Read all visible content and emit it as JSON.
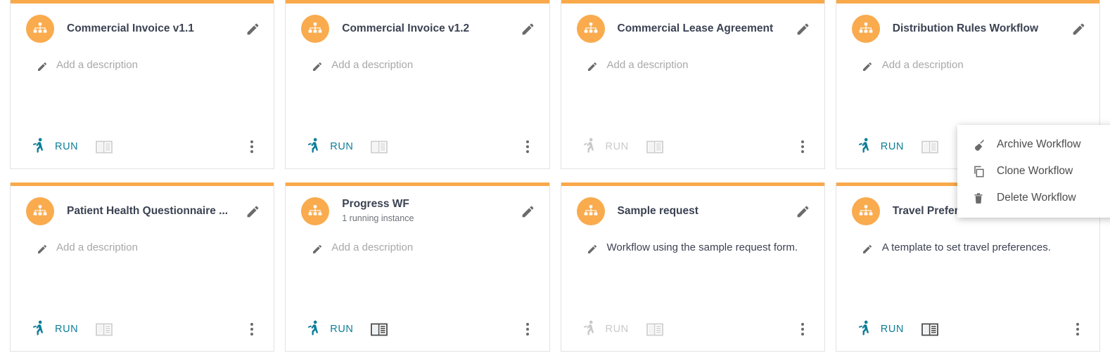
{
  "accent_orange": "#f9a94a",
  "run_teal": "#0d7e98",
  "disabled_grey": "#c9c9c9",
  "labels": {
    "run": "RUN",
    "add_description": "Add a description"
  },
  "cards": [
    {
      "title": "Commercial Invoice v1.1",
      "subtitle": "",
      "description": "Add a description",
      "description_filled": false,
      "run_enabled": true,
      "view_enabled": false
    },
    {
      "title": "Commercial Invoice v1.2",
      "subtitle": "",
      "description": "Add a description",
      "description_filled": false,
      "run_enabled": true,
      "view_enabled": false
    },
    {
      "title": "Commercial Lease Agreement",
      "subtitle": "",
      "description": "Add a description",
      "description_filled": false,
      "run_enabled": false,
      "view_enabled": false
    },
    {
      "title": "Distribution Rules Workflow",
      "subtitle": "",
      "description": "Add a description",
      "description_filled": false,
      "run_enabled": true,
      "view_enabled": false
    },
    {
      "title": "Patient Health Questionnaire ...",
      "subtitle": "",
      "description": "Add a description",
      "description_filled": false,
      "run_enabled": true,
      "view_enabled": false
    },
    {
      "title": "Progress WF",
      "subtitle": "1 running instance",
      "description": "Add a description",
      "description_filled": false,
      "run_enabled": true,
      "view_enabled": true
    },
    {
      "title": "Sample request",
      "subtitle": "",
      "description": "Workflow using the sample request form.",
      "description_filled": true,
      "run_enabled": false,
      "view_enabled": false
    },
    {
      "title": "Travel Preferences",
      "subtitle": "",
      "description": "A template to set travel preferences.",
      "description_filled": true,
      "run_enabled": true,
      "view_enabled": true
    }
  ],
  "context_menu": {
    "items": [
      {
        "label": "Archive Workflow",
        "icon": "broom-icon"
      },
      {
        "label": "Clone Workflow",
        "icon": "copy-icon"
      },
      {
        "label": "Delete Workflow",
        "icon": "trash-icon"
      }
    ]
  }
}
